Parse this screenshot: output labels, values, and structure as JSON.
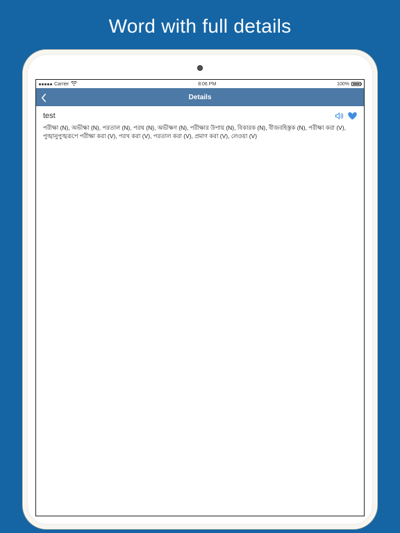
{
  "promo_title": "Word with full details",
  "status": {
    "carrier": "Carrier",
    "time": "8:06 PM",
    "battery": "100%"
  },
  "nav": {
    "title": "Details",
    "back_label": "Back"
  },
  "word": {
    "headword": "test",
    "definition": "পরীক্ষা (N), অভীক্ষা (N), পরতাল (N), পরথ (N), অভীক্ষণ (N), পরীক্ষার উপায় (N), বিকারক (N), বীজবহিস্তৃক (N), পরীক্ষা করা (V), পুঙ্খানুপুঙ্খরূপে পরীক্ষা করা (V), পরখ করা (V), পরতাল করা (V), প্রমাণ করা (V), লেওয়া (V)"
  },
  "colors": {
    "bg": "#1565a5",
    "navbar": "#4c79a5",
    "accent": "#3f8de0"
  },
  "icons": {
    "back": "chevron-left",
    "speaker": "speaker-icon",
    "favorite": "heart-icon"
  }
}
